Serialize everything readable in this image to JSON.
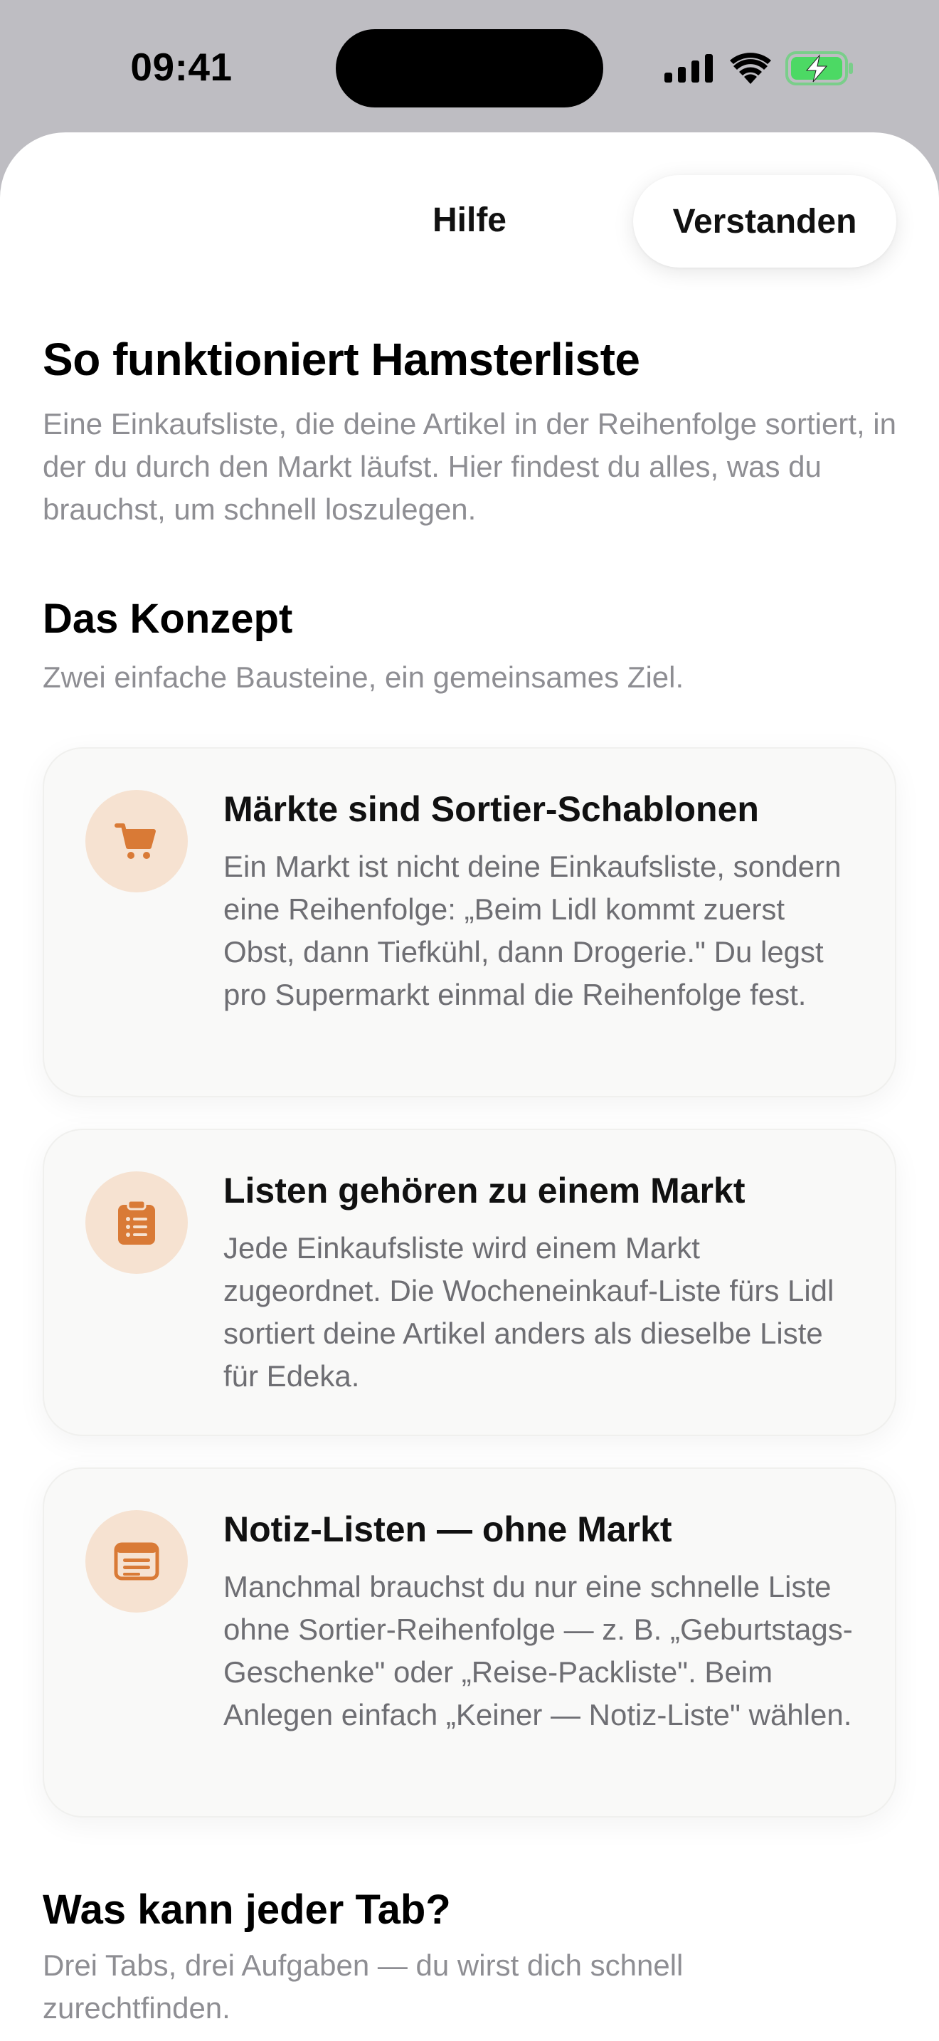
{
  "status_bar": {
    "time": "09:41",
    "icons": [
      "cellular-signal-icon",
      "wifi-icon",
      "battery-charging-icon"
    ],
    "battery_color": "#4cd964"
  },
  "nav": {
    "title": "Hilfe",
    "confirm_label": "Verstanden"
  },
  "header": {
    "title": "So funktioniert Hamsterliste",
    "intro": "Eine Einkaufsliste, die deine Artikel in der Reihenfolge sortiert, in der du durch den Markt läufst. Hier findest du alles, was du brauchst, um schnell loszulegen."
  },
  "concept": {
    "title": "Das Konzept",
    "subtitle": "Zwei einfache Bausteine, ein gemeinsames Ziel.",
    "cards": [
      {
        "icon": "shopping-cart-icon",
        "title": "Märkte sind Sortier-Schablonen",
        "text": "Ein Markt ist nicht deine Einkaufsliste, sondern eine Reihenfolge: „Beim Lidl kommt zuerst Obst, dann Tiefkühl, dann Drogerie.\" Du legst pro Supermarkt einmal die Reihenfolge fest."
      },
      {
        "icon": "clipboard-list-icon",
        "title": "Listen gehören zu einem Markt",
        "text": "Jede Einkaufsliste wird einem Markt zugeordnet. Die Wocheneinkauf-Liste fürs Lidl sortiert deine Artikel anders als dieselbe Liste für Edeka."
      },
      {
        "icon": "note-icon",
        "title": "Notiz-Listen — ohne Markt",
        "text": "Manchmal brauchst du nur eine schnelle Liste ohne Sortier-Reihenfolge — z. B. „Geburtstags-Geschenke\" oder „Reise-Packliste\". Beim Anlegen einfach „Keiner — Notiz-Liste\" wählen."
      }
    ]
  },
  "tabs_section": {
    "title": "Was kann jeder Tab?",
    "subtitle": "Drei Tabs, drei Aufgaben — du wirst dich schnell zurechtfinden."
  },
  "colors": {
    "accent": "#d97a36",
    "icon_background": "#f6e2d1",
    "secondary_text": "#8e8e93"
  }
}
